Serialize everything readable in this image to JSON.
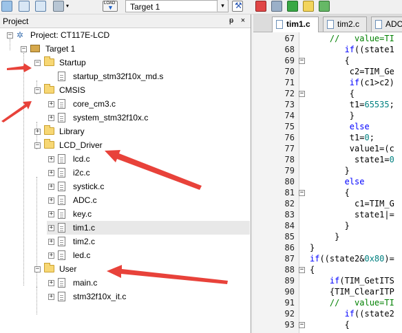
{
  "toolbar": {
    "target_select": "Target 1",
    "icons": [
      "build-icon",
      "rebuild-icon",
      "batch-build-icon",
      "layers-icon",
      "load-icon",
      "options-icon",
      "manage-icon",
      "pack-icon",
      "green-arrows-icon",
      "config-icon",
      "settings-icon"
    ],
    "load_label": "LOAD"
  },
  "panel": {
    "title": "Project",
    "pin": "ᵽ",
    "close": "×"
  },
  "tree": {
    "project": "Project: CT117E-LCD",
    "target": "Target 1",
    "groups": [
      {
        "name": "Startup",
        "files": [
          "startup_stm32f10x_md.s"
        ]
      },
      {
        "name": "CMSIS",
        "files": [
          "core_cm3.c",
          "system_stm32f10x.c"
        ]
      },
      {
        "name": "Library",
        "files": []
      },
      {
        "name": "LCD_Driver",
        "files": [
          "lcd.c",
          "i2c.c",
          "systick.c",
          "ADC.c",
          "key.c",
          "tim1.c",
          "tim2.c",
          "led.c"
        ]
      },
      {
        "name": "User",
        "files": [
          "main.c",
          "stm32f10x_it.c"
        ]
      }
    ]
  },
  "editor": {
    "tabs": [
      "tim1.c",
      "tim2.c",
      "ADC"
    ],
    "line_numbers": [
      67,
      68,
      69,
      70,
      71,
      72,
      73,
      74,
      75,
      76,
      77,
      78,
      79,
      80,
      81,
      82,
      83,
      84,
      85,
      86,
      87,
      88,
      89,
      90,
      91,
      92,
      93
    ],
    "lines": [
      "    //   value=TI",
      "       if((state1",
      "       {",
      "        c2=TIM_Ge",
      "        if(c1>c2)",
      "        {",
      "        t1=65535;",
      "        }",
      "        else",
      "        t1=0;",
      "        value1=(c",
      "         state1=0",
      "       }",
      "       else",
      "       {",
      "         c1=TIM_G",
      "         state1|=",
      "       }",
      "     }",
      "}",
      "if((state2&0x80)=",
      "{",
      "    if(TIM_GetITS",
      "    {TIM_ClearITP",
      "    //   value=TI",
      "       if((state2",
      "       {"
    ]
  }
}
